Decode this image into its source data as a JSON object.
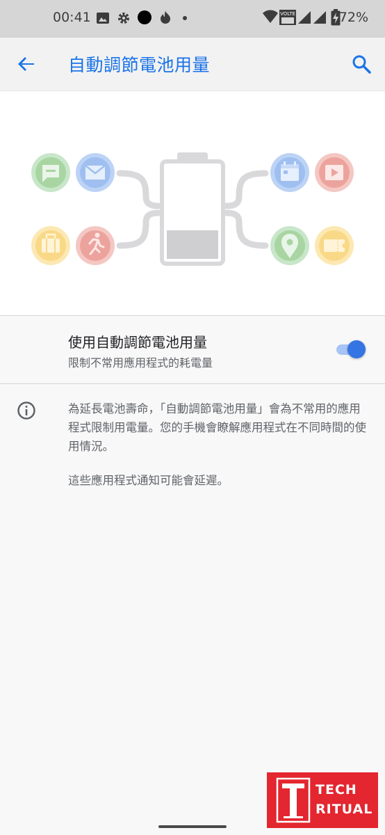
{
  "status_bar": {
    "time": "00:41",
    "battery_percent": "72%",
    "volte_label": "VoLTE"
  },
  "app_bar": {
    "title": "自動調節電池用量",
    "accent_color": "#1a73e8"
  },
  "illustration": {
    "left_icons": [
      "message-icon",
      "mail-icon",
      "briefcase-icon",
      "running-icon"
    ],
    "right_icons": [
      "calendar-icon",
      "video-icon",
      "location-icon",
      "ticket-icon"
    ],
    "battery_level": 0.3
  },
  "setting": {
    "title": "使用自動調節電池用量",
    "summary": "限制不常用應用程式的耗電量",
    "enabled": true
  },
  "info": {
    "paragraph1": "為延長電池壽命，「自動調節電池用量」會為不常用的應用程式限制用電量。您的手機會瞭解應用程式在不同時間的使用情況。",
    "paragraph2": "這些應用程式通知可能會延遲。"
  },
  "watermark": {
    "line1": "TECH",
    "line2": "RITUAL"
  }
}
